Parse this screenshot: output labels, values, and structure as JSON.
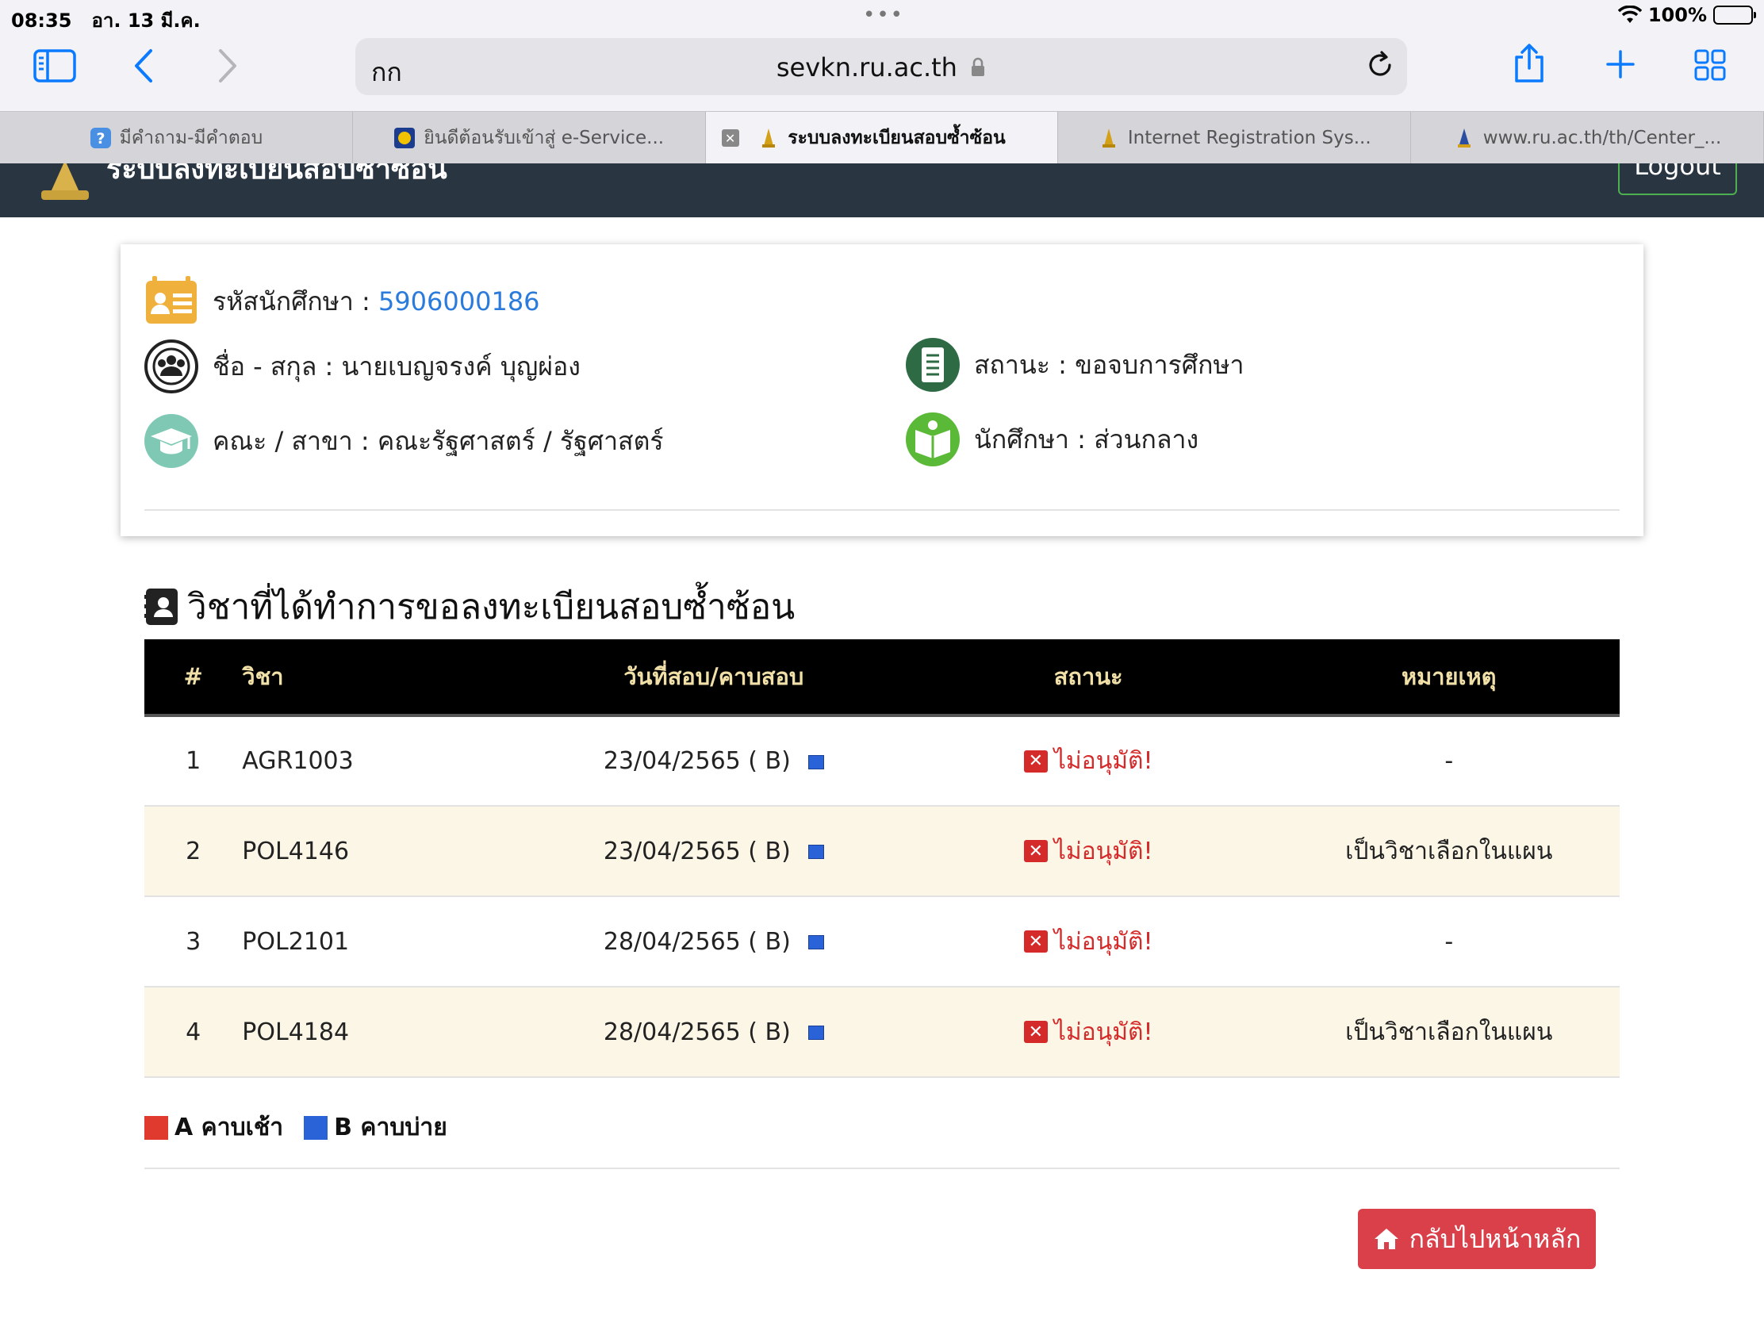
{
  "status_bar": {
    "time": "08:35",
    "date": "อา. 13 มี.ค.",
    "battery": "100%"
  },
  "browser": {
    "text_size_label": "กก",
    "url": "sevkn.ru.ac.th",
    "tabs": [
      {
        "label": "มีคำถาม-มีคำตอบ",
        "active": false
      },
      {
        "label": "ยินดีต้อนรับเข้าสู่ e-Service...",
        "active": false
      },
      {
        "label": "ระบบลงทะเบียนสอบซ้ำซ้อน",
        "active": true
      },
      {
        "label": "Internet Registration Sys...",
        "active": false
      },
      {
        "label": "www.ru.ac.th/th/Center_...",
        "active": false
      }
    ]
  },
  "site": {
    "title": "ระบบลงทะเบียนสอบซ้ำซ้อน",
    "logout_label": "Logout"
  },
  "student": {
    "id_label": "รหัสนักศึกษา :",
    "id_value": "5906000186",
    "name_text": "ชื่อ - สกุล : นายเบญจรงค์ บุญผ่อง",
    "status_text": "สถานะ : ขอจบการศึกษา",
    "faculty_text": "คณะ / สาขา : คณะรัฐศาสตร์ / รัฐศาสตร์",
    "type_text": "นักศึกษา : ส่วนกลาง"
  },
  "section": {
    "title": "วิชาที่ได้ทำการขอลงทะเบียนสอบซ้ำซ้อน"
  },
  "table": {
    "headers": {
      "num": "#",
      "subject": "วิชา",
      "date": "วันที่สอบ/คาบสอบ",
      "status": "สถานะ",
      "note": "หมายเหตุ"
    },
    "rows": [
      {
        "num": "1",
        "subject": "AGR1003",
        "date": "23/04/2565 ( B)",
        "status": "ไม่อนุมัติ!",
        "note": "-"
      },
      {
        "num": "2",
        "subject": "POL4146",
        "date": "23/04/2565 ( B)",
        "status": "ไม่อนุมัติ!",
        "note": "เป็นวิชาเลือกในแผน"
      },
      {
        "num": "3",
        "subject": "POL2101",
        "date": "28/04/2565 ( B)",
        "status": "ไม่อนุมัติ!",
        "note": "-"
      },
      {
        "num": "4",
        "subject": "POL4184",
        "date": "28/04/2565 ( B)",
        "status": "ไม่อนุมัติ!",
        "note": "เป็นวิชาเลือกในแผน"
      }
    ]
  },
  "legend": {
    "a_label": "A คาบเช้า",
    "a_color": "#e03a2e",
    "b_label": "B คาบบ่าย",
    "b_color": "#2a62d8"
  },
  "home_button": {
    "label": "กลับไปหน้าหลัก"
  },
  "colors": {
    "header_bg": "#2a3542",
    "reject": "#d42a2a",
    "link": "#2a7bdc",
    "button": "#d9404a",
    "row_alt": "#fcf6e6"
  }
}
